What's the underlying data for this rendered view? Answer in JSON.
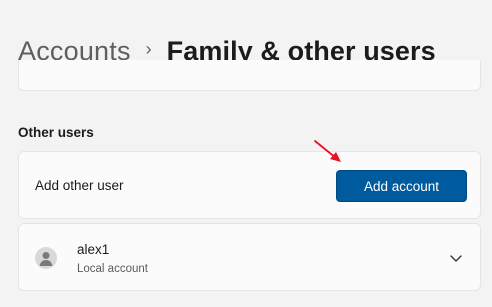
{
  "header": {
    "breadcrumb_parent": "Accounts",
    "breadcrumb_separator": "›",
    "page_title": "Family & other users"
  },
  "other_users": {
    "heading": "Other users",
    "add_row_label": "Add other user",
    "add_button_label": "Add account",
    "accounts": [
      {
        "name": "alex1",
        "type": "Local account",
        "icon": "person-icon"
      }
    ]
  },
  "colors": {
    "background": "#f3f3f3",
    "card": "#fbfbfb",
    "accent": "#005a9e",
    "annotation_arrow": "#e81123"
  }
}
